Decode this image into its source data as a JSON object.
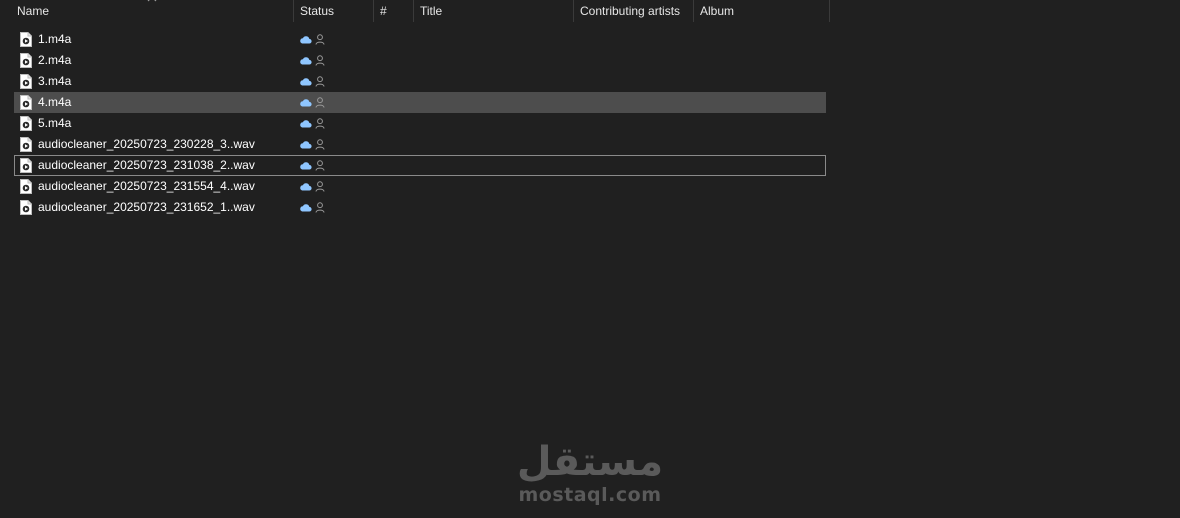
{
  "columns": {
    "name": "Name",
    "status": "Status",
    "number": "#",
    "title": "Title",
    "contributing_artists": "Contributing artists",
    "album": "Album"
  },
  "files": [
    {
      "name": "1.m4a",
      "status": "available online-only",
      "state": "normal"
    },
    {
      "name": "2.m4a",
      "status": "available online-only",
      "state": "normal"
    },
    {
      "name": "3.m4a",
      "status": "available online-only",
      "state": "normal"
    },
    {
      "name": "4.m4a",
      "status": "available online-only",
      "state": "selected"
    },
    {
      "name": "5.m4a",
      "status": "available online-only",
      "state": "normal"
    },
    {
      "name": "audiocleaner_20250723_230228_3..wav",
      "status": "available online-only",
      "state": "normal"
    },
    {
      "name": "audiocleaner_20250723_231038_2..wav",
      "status": "available online-only",
      "state": "focused"
    },
    {
      "name": "audiocleaner_20250723_231554_4..wav",
      "status": "available online-only",
      "state": "normal"
    },
    {
      "name": "audiocleaner_20250723_231652_1..wav",
      "status": "available online-only",
      "state": "normal"
    }
  ],
  "icons": {
    "file": "audio-file-icon",
    "cloud": "cloud-icon",
    "shared": "person-icon",
    "sort": "chevron-up-icon"
  },
  "colors": {
    "background": "#202020",
    "selected_row": "#4d4d4d",
    "focus_border": "#8a8a8a",
    "cloud": "#8fc6ff",
    "watermark": "#5a5a5a"
  },
  "watermark": {
    "arabic": "مستقل",
    "latin": "mostaql.com"
  }
}
